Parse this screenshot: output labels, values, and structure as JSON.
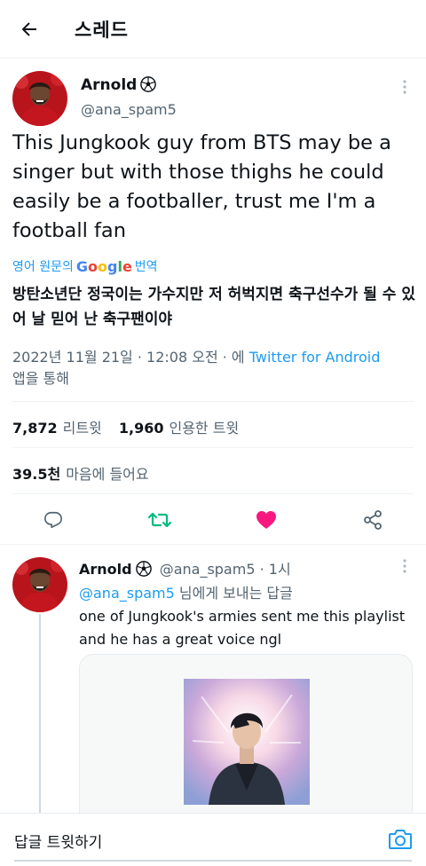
{
  "header": {
    "title": "스레드"
  },
  "tweet": {
    "display_name": "Arnold",
    "handle": "@ana_spam5",
    "text": "This Jungkook guy from BTS may be a singer but with those thighs he could easily be a footballer, trust me I'm a football fan",
    "translate_prefix": "영어 원문의",
    "translate_brand": "Google",
    "translate_suffix": "번역",
    "translated_text": "방탄소년단 정국이는 가수지만 저 허벅지면 축구선수가 될 수 있어 날 믿어 난 축구팬이야",
    "timestamp": "2022년 11월 21일 · 12:08 오전 · 에",
    "source": "Twitter for Android",
    "source_suffix": "앱을 통해",
    "retweets_count": "7,872",
    "retweets_label": "리트윗",
    "quotes_count": "1,960",
    "quotes_label": "인용한 트윗",
    "likes_count": "39.5천",
    "likes_label": "마음에 들어요"
  },
  "reply": {
    "display_name": "Arnold",
    "handle": "@ana_spam5",
    "time": "· 1시",
    "reply_to_handle": "@ana_spam5",
    "reply_to_suffix": "님에게 보내는 답글",
    "text": "one of Jungkook's armies sent me this playlist and he has a great voice ngl"
  },
  "composer": {
    "placeholder": "답글 트윗하기"
  },
  "colors": {
    "accent": "#1d9bf0",
    "retweet": "#00ba7c",
    "like": "#f91880",
    "muted": "#536471"
  },
  "icons": [
    "back-arrow-icon",
    "soccer-ball-icon",
    "more-icon",
    "reply-icon",
    "retweet-icon",
    "like-icon",
    "share-icon",
    "camera-icon"
  ]
}
